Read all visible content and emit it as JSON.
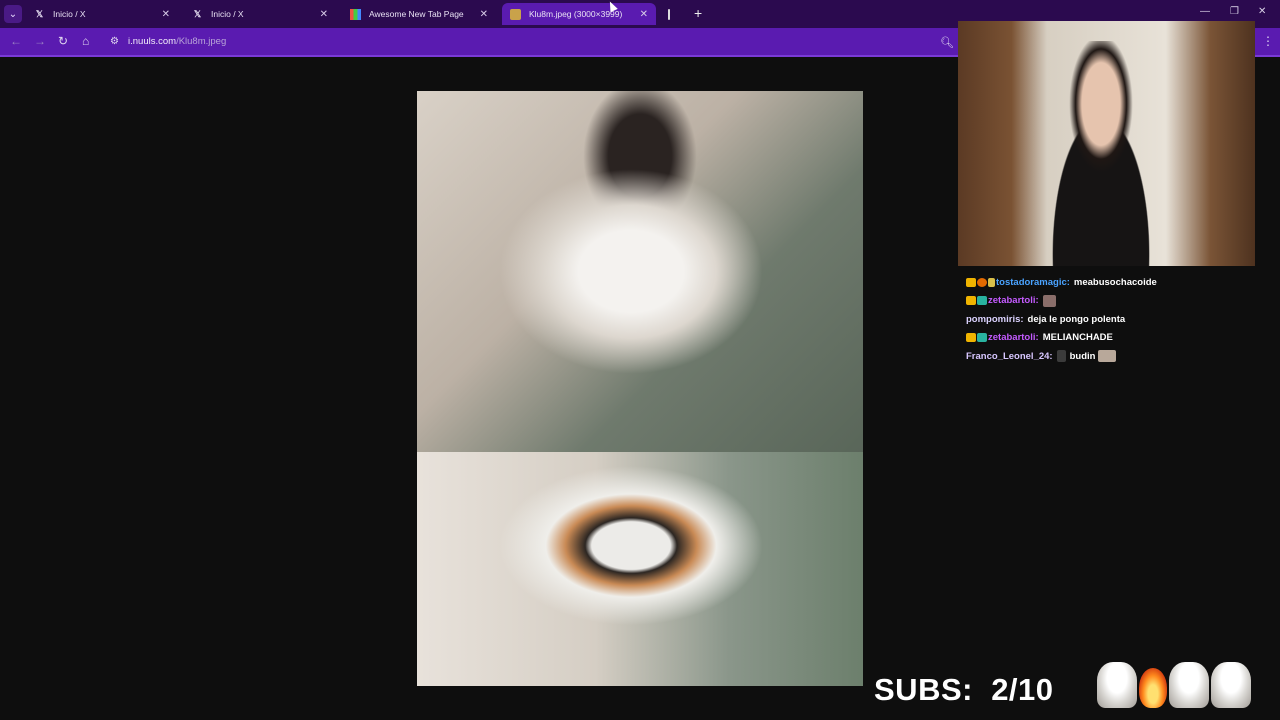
{
  "browser": {
    "tabs": [
      {
        "label": "Inicio / X",
        "icon": "x-logo-icon",
        "active": false
      },
      {
        "label": "Inicio / X",
        "icon": "x-logo-icon",
        "active": false
      },
      {
        "label": "Awesome New Tab Page",
        "icon": "grid-icon",
        "active": false
      },
      {
        "label": "Klu8m.jpeg (3000×3999)",
        "icon": "image-icon",
        "active": true
      }
    ],
    "new_tab_label": "+",
    "address_bar": {
      "domain": "i.nuuls.com",
      "path": "/Klu8m.jpeg"
    },
    "accent_color": "#5a1bb0",
    "tabbar_color": "#2b0a4f"
  },
  "stream": {
    "chat": [
      {
        "user": "tostadoramagic:",
        "user_color": "#4aa3ff",
        "badges": [
          "crown",
          "orange",
          "pen"
        ],
        "message": "meabusochacoide",
        "emote": ""
      },
      {
        "user": "zetabartoli:",
        "user_color": "#c45bff",
        "badges": [
          "crown",
          "teal"
        ],
        "message": "",
        "emote": "e1"
      },
      {
        "user": "pompomiris:",
        "user_color": "#dcd3ff",
        "badges": [],
        "message": "deja le pongo polenta",
        "emote": ""
      },
      {
        "user": "zetabartoli:",
        "user_color": "#c45bff",
        "badges": [
          "crown",
          "teal"
        ],
        "message": "MELIANCHADE",
        "emote": ""
      },
      {
        "user": "Franco_Leonel_24:",
        "user_color": "#d8c7ff",
        "badges": [],
        "message": "budin",
        "emote": "e2e3"
      }
    ],
    "subs_label": "SUBS:",
    "subs_value": "2/10"
  }
}
